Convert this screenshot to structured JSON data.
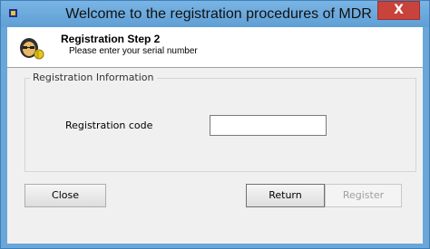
{
  "window": {
    "title": "Welcome to the registration procedures of MDR",
    "close_glyph": "X",
    "app_icon": "app-icon",
    "close_color": "#c7433b",
    "titlebar_color": "#6aa7d8"
  },
  "header": {
    "icon": "wizard-icon",
    "step_title": "Registration Step 2",
    "step_subtitle": "Please enter your serial number"
  },
  "group": {
    "legend": "Registration Information",
    "field_label": "Registration code",
    "field_value": ""
  },
  "buttons": {
    "close": "Close",
    "return": "Return",
    "register": "Register"
  }
}
